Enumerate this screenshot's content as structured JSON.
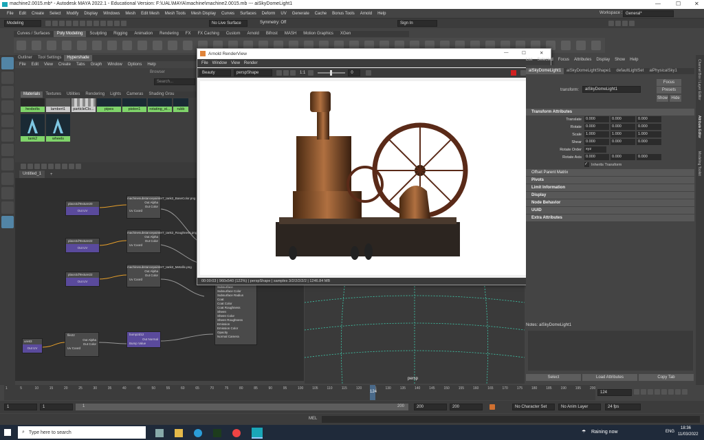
{
  "window": {
    "title": "machine2.0015.mb* - Autodesk MAYA 2022.1 - Educational Version: F:\\UAL\\MAYA\\machine\\machine2.0015.mb  ---  aiSkyDomeLight1",
    "min": "—",
    "max": "☐",
    "close": "✕"
  },
  "menu": [
    "File",
    "Edit",
    "Create",
    "Select",
    "Modify",
    "Display",
    "Windows",
    "Mesh",
    "Edit Mesh",
    "Mesh Tools",
    "Mesh Display",
    "Curves",
    "Surfaces",
    "Deform",
    "UV",
    "Generate",
    "Cache",
    "Bonus Tools",
    "Arnold",
    "Help"
  ],
  "workspace": {
    "label": "Workspace :",
    "value": "General*"
  },
  "status": {
    "mode": "Modeling",
    "live": "No Live Surface",
    "symmetry": "Symmetry: Off",
    "signin": "Sign In"
  },
  "shelf_tabs": [
    "Curves / Surfaces",
    "Poly Modeling",
    "Sculpting",
    "Rigging",
    "Animation",
    "Rendering",
    "FX",
    "FX Caching",
    "Custom",
    "Arnold",
    "Bifrost",
    "MASH",
    "Motion Graphics",
    "XGen"
  ],
  "hypershade": {
    "top_tabs": [
      "Outliner",
      "Tool Settings",
      "Hypershade"
    ],
    "menu": [
      "File",
      "Edit",
      "View",
      "Create",
      "Tabs",
      "Graph",
      "Window",
      "Options",
      "Help"
    ],
    "browser": "Browser",
    "search": "Search...",
    "tabs": [
      "Materials",
      "Textures",
      "Utilities",
      "Rendering",
      "Lights",
      "Cameras",
      "Shading Grou"
    ],
    "swatches_row1": [
      "hexbolts",
      "lambert1",
      "particleClo...",
      "pipes",
      "piston1",
      "rotating_st...",
      "rubb"
    ],
    "swatches_row2": [
      "tank2",
      "wheels"
    ]
  },
  "node_editor": {
    "tab": "Untitled_1",
    "add": "+",
    "nodes": [
      {
        "title": "place2dTexture20",
        "out": "Out UV"
      },
      {
        "title": "place2dTexture22",
        "out": "Out UV"
      },
      {
        "title": "place2dTexture22",
        "out": "Out UV"
      },
      {
        "title": "machinesubstancepainter7_tank2_BaseColor.png",
        "a": "Out Alpha",
        "c": "Out Color",
        "uv": "Uv Coord"
      },
      {
        "title": "machinesubstancepainter7_tank2_Roughness.png",
        "a": "Out Alpha",
        "c": "Out Color",
        "uv": "Uv Coord"
      },
      {
        "title": "machinesubstancepainter7_tank2_Metallic.png",
        "a": "Out Alpha",
        "c": "Out Color",
        "uv": "Uv Coord"
      },
      {
        "title": "ure83",
        "out": "Out UV"
      },
      {
        "title": "file22",
        "a": "Out Alpha",
        "c": "Out Color",
        "uv": "Uv Coord"
      },
      {
        "title": "bump2d12",
        "a": "Out Normal",
        "c": "Bump Value"
      }
    ],
    "shader_attrs": [
      "Subsurface",
      "Subsurface Color",
      "Subsurface Radius",
      "Coat",
      "Coat Color",
      "Coat Roughness",
      "Sheen",
      "Sheen Color",
      "Sheen Roughness",
      "Emission",
      "Emission Color",
      "Opacity",
      "Normal Camera"
    ]
  },
  "render_view": {
    "title": "Arnold RenderView",
    "menu": [
      "File",
      "Window",
      "View",
      "Render"
    ],
    "aov": "Beauty",
    "camera": "perspShape",
    "ratio": "1:1",
    "exposure": "0",
    "status": "00:00:03 | 960x540 (122%) | perspShape | samples 3/2/2/2/2/2 | 1246.84 MB"
  },
  "viewport": {
    "camera": "persp"
  },
  "attr_editor": {
    "tabs": [
      "aiSkyDomeLight1",
      "aiSkyDomeLightShape1",
      "defaultLightSet",
      "aiPhysicalSky1"
    ],
    "menu": [
      "List",
      "Selected",
      "Focus",
      "Attributes",
      "Display",
      "Show",
      "Help"
    ],
    "transform_label": "transform:",
    "transform_value": "aiSkyDomeLight1",
    "focus": "Focus",
    "presets": "Presets",
    "show": "Show",
    "hide": "Hide",
    "section": "Transform Attributes",
    "rows": [
      {
        "label": "Translate",
        "v": [
          "0.000",
          "0.000",
          "0.000"
        ]
      },
      {
        "label": "Rotate",
        "v": [
          "0.000",
          "0.000",
          "0.000"
        ]
      },
      {
        "label": "Scale",
        "v": [
          "1.000",
          "1.000",
          "1.000"
        ]
      },
      {
        "label": "Shear",
        "v": [
          "0.000",
          "0.000",
          "0.000"
        ]
      }
    ],
    "rotate_order_label": "Rotate Order",
    "rotate_order": "xyz",
    "rotate_axis_label": "Rotate Axis",
    "rotate_axis": [
      "0.000",
      "0.000",
      "0.000"
    ],
    "inherits": "Inherits Transform",
    "offset": "Offset Parent Matrix",
    "collapsed": [
      "Pivots",
      "Limit Information",
      "Display",
      "Node Behavior",
      "UUID",
      "Extra Attributes"
    ],
    "notes": "Notes: aiSkyDomeLight1",
    "buttons": [
      "Select",
      "Load Attributes",
      "Copy Tab"
    ]
  },
  "right_tabs": [
    "Channel Box / Layer Editor",
    "Attribute Editor",
    "Modeling Toolkit"
  ],
  "timeline": {
    "ticks": [
      "1",
      "5",
      "10",
      "15",
      "20",
      "25",
      "30",
      "35",
      "40",
      "45",
      "50",
      "55",
      "60",
      "65",
      "70",
      "75",
      "80",
      "85",
      "90",
      "95",
      "100",
      "105",
      "110",
      "115",
      "120",
      "125",
      "130",
      "135",
      "140",
      "145",
      "150",
      "155",
      "160",
      "165",
      "170",
      "175",
      "180",
      "185",
      "190",
      "195",
      "200"
    ],
    "current": "124",
    "frame_field": "124"
  },
  "range": {
    "start": "1",
    "start2": "1",
    "range_start": "1",
    "range_end": "200",
    "end1": "200",
    "end2": "200",
    "character": "No Character Set",
    "anim": "No Anim Layer",
    "fps": "24 fps"
  },
  "cmd": {
    "mel": "MEL"
  },
  "taskbar": {
    "search": "Type here to search",
    "weather": "Raining now",
    "lang": "ENG",
    "time": "18:36",
    "date": "11/03/2022"
  }
}
